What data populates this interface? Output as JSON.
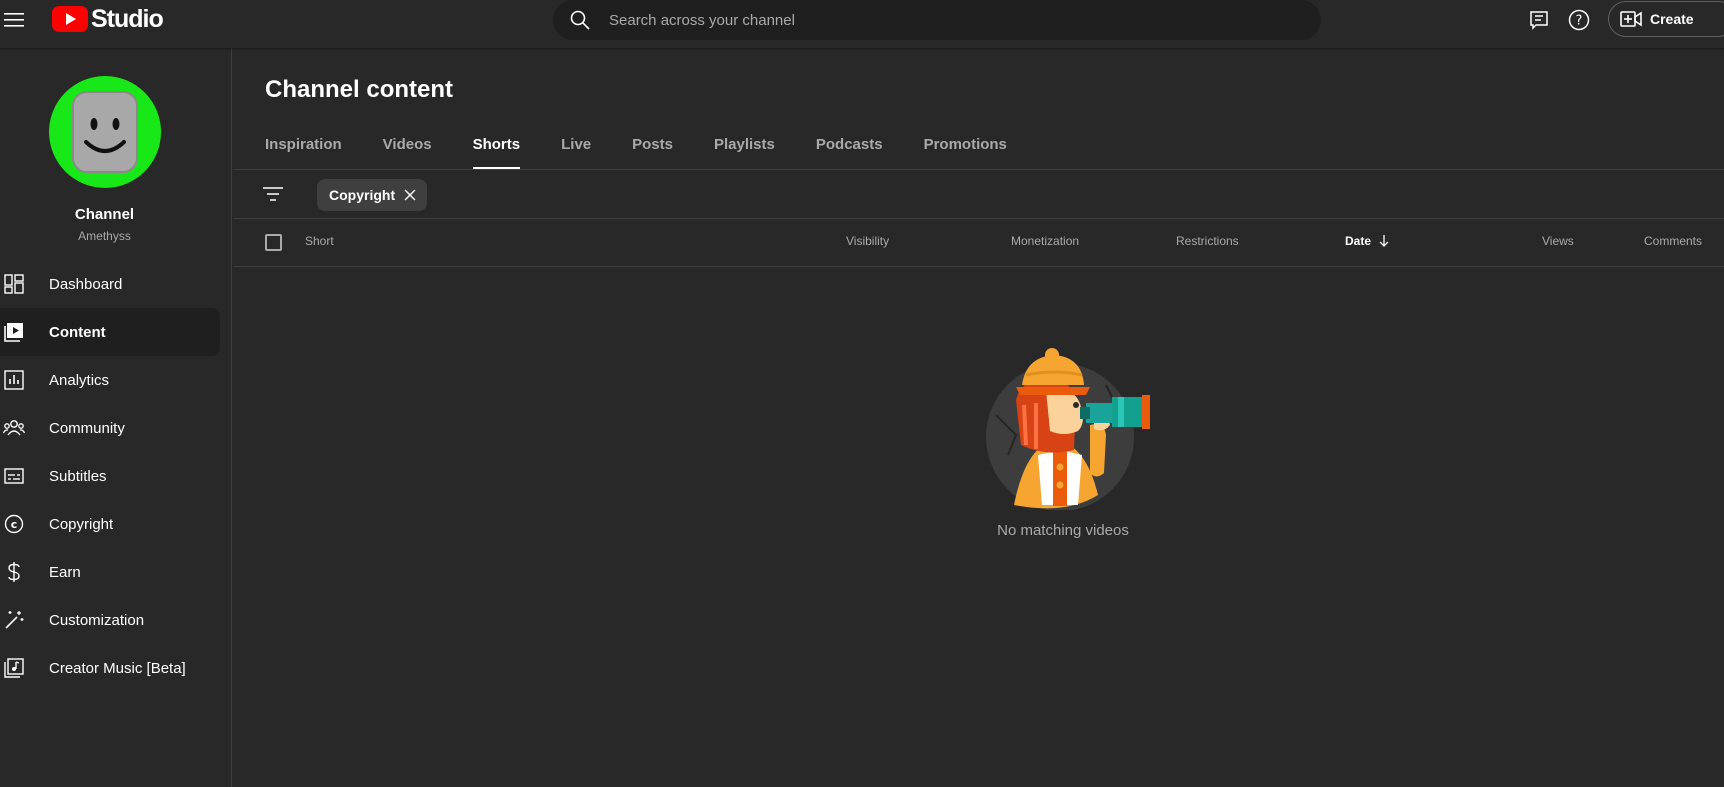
{
  "header": {
    "app_name": "Studio",
    "search_placeholder": "Search across your channel",
    "create_label": "Create"
  },
  "channel": {
    "name": "Channel",
    "handle": "Amethyss"
  },
  "nav": {
    "dashboard": "Dashboard",
    "content": "Content",
    "analytics": "Analytics",
    "community": "Community",
    "subtitles": "Subtitles",
    "copyright": "Copyright",
    "earn": "Earn",
    "customization": "Customization",
    "music": "Creator Music [Beta]"
  },
  "main": {
    "title": "Channel content",
    "tabs": {
      "inspiration": "Inspiration",
      "videos": "Videos",
      "shorts": "Shorts",
      "live": "Live",
      "posts": "Posts",
      "playlists": "Playlists",
      "podcasts": "Podcasts",
      "promotions": "Promotions"
    },
    "active_tab": "Shorts",
    "filter_chip": "Copyright",
    "columns": {
      "short": "Short",
      "visibility": "Visibility",
      "monetization": "Monetization",
      "restrictions": "Restrictions",
      "date": "Date",
      "views": "Views",
      "comments": "Comments"
    },
    "sorted_by": "Date",
    "empty_message": "No matching videos"
  },
  "colors": {
    "background": "#282828",
    "sidebar_active": "#1f1f1f",
    "search_bg": "#1f1f1f",
    "brand_red": "#ff0000",
    "avatar_ring": "#18e818",
    "muted_text": "#aaaaaa"
  },
  "icons": {
    "menu": "menu-icon",
    "search": "search-icon",
    "feedback": "feedback-icon",
    "help": "help-icon",
    "create": "create-video-icon",
    "filter": "filter-icon",
    "chip_close": "close-icon",
    "sort": "arrow-down-icon"
  }
}
